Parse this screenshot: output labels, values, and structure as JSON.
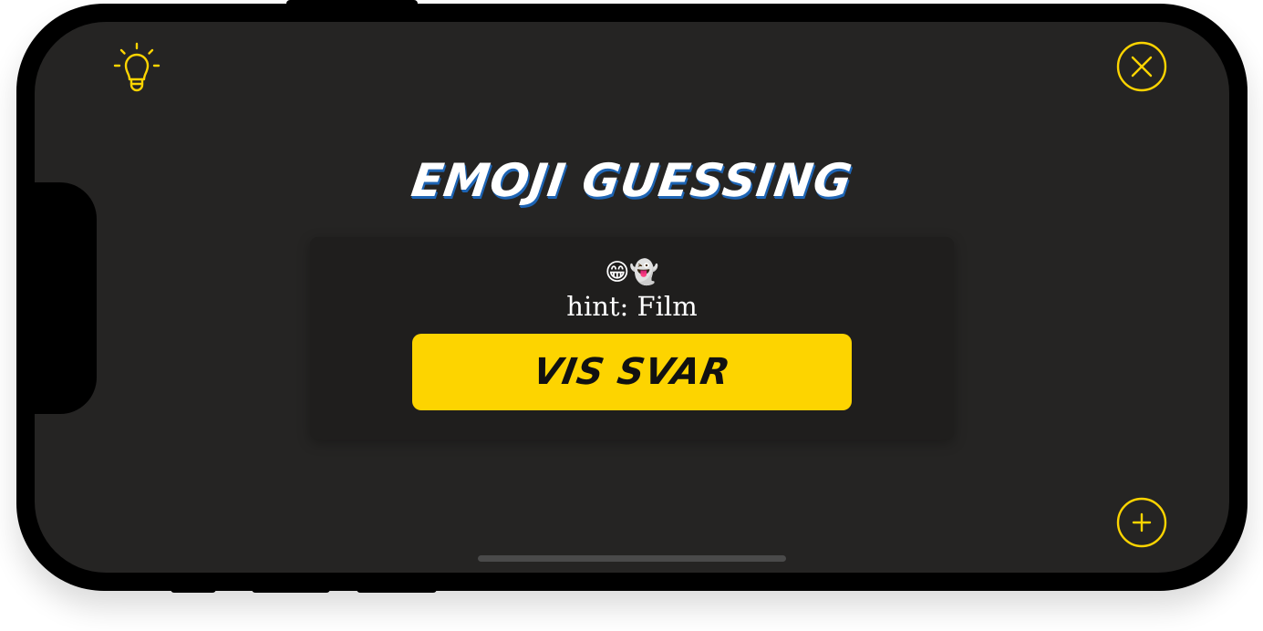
{
  "app": {
    "title": "EMOJI GUESSING"
  },
  "card": {
    "emojis": "😁👻",
    "hint": "hint: Film",
    "reveal_button_label": "VIS SVAR"
  },
  "toolbar": {
    "hint_icon": "lightbulb-icon",
    "close_icon": "close-icon",
    "add_icon": "plus-icon"
  },
  "colors": {
    "accent": "#fdd400",
    "background": "#252423",
    "card": "#1f1e1d",
    "title_shadow": "#1d64b4"
  }
}
